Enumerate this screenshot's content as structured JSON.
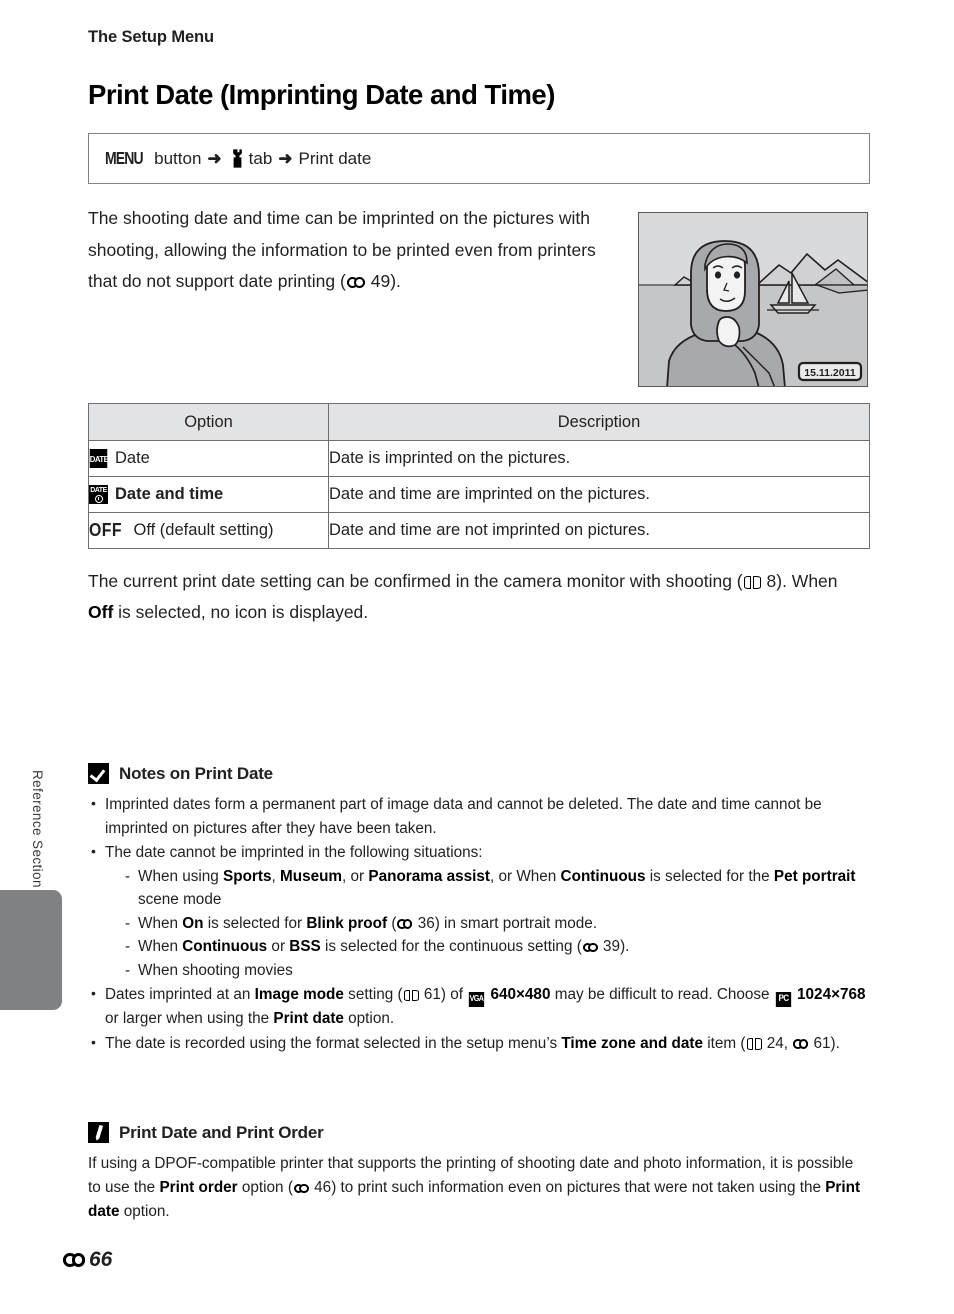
{
  "side_tab": {
    "label": "Reference Section"
  },
  "running_head": "The Setup Menu",
  "page_title": "Print Date (Imprinting Date and Time)",
  "menu_path": {
    "menu_label": "MENU",
    "button_word": "button",
    "arrow": "➜",
    "tab_icon": "wrench-icon",
    "tab_word": "tab",
    "destination": "Print date"
  },
  "intro": {
    "line1": "The shooting date and time can be imprinted on the",
    "line2": "pictures with shooting, allowing the information to be",
    "line3": "printed even from printers that do not support date",
    "line4_pre": "printing (",
    "line4_ref": "49",
    "line4_post": ")."
  },
  "camera_figure": {
    "alt": "camera monitor showing woman with sailboat and date stamp",
    "date_stamp": "15.11.2011",
    "sky_color": "#d9dadb",
    "sea_color": "#c5c6c8",
    "subject_color": "#a7a9ac"
  },
  "options_table": {
    "headers": [
      "Option",
      "Description"
    ],
    "rows": [
      {
        "icon": "date-badge-icon",
        "icon_text": "DATE",
        "option": "Date",
        "description": "Date is imprinted on the pictures."
      },
      {
        "icon": "date-time-badge-icon",
        "icon_text": "DATE",
        "option": "Date and time",
        "description": "Date and time are imprinted on the pictures."
      },
      {
        "icon": "off-glyph-icon",
        "icon_text": "OFF",
        "option": "Off (default setting)",
        "description": "Date and time are not imprinted on pictures."
      }
    ]
  },
  "confirm_paragraph": {
    "part1": "The current print date setting can be confirmed in the camera monitor with shooting (",
    "ref": "8",
    "part2": "). When ",
    "bold": "Off",
    "part3": " is selected, no icon is displayed."
  },
  "notes": {
    "icon": "check-box-icon",
    "title": "Notes on Print Date",
    "bullet1": "Imprinted dates form a permanent part of image data and cannot be deleted. The date and time cannot be imprinted on pictures after they have been taken.",
    "bullet2_lead": "The date cannot be imprinted in the following situations:",
    "sub1": {
      "t1": "When using ",
      "b1": "Sports",
      "t2": ", ",
      "b2": "Museum",
      "t3": ", or ",
      "b3": "Panorama assist",
      "t4": ", or When ",
      "b4": "Continuous",
      "t5": " is selected for the ",
      "b5": "Pet portrait",
      "t6": " scene mode"
    },
    "sub2": {
      "t1": "When ",
      "b1": "On",
      "t2": " is selected for ",
      "b2": "Blink proof",
      "t3": " (",
      "ref": "36",
      "t4": ") in smart portrait mode."
    },
    "sub3": {
      "t1": "When ",
      "b1": "Continuous",
      "t2": " or ",
      "b2": "BSS",
      "t3": " is selected for the continuous setting (",
      "ref": "39",
      "t4": ")."
    },
    "sub4": "When shooting movies",
    "bullet3": {
      "t1": "Dates imprinted at an ",
      "b1": "Image mode",
      "t2": " setting (",
      "ref1": "61",
      "t3": ") of ",
      "badge1": "VGA",
      "b2": "640×480",
      "t4": " may be difficult to read. Choose ",
      "badge2": "PC",
      "b3": "1024×768",
      "t5": " or larger when using the ",
      "b4": "Print date",
      "t6": " option."
    },
    "bullet4": {
      "t1": "The date is recorded using the format selected in the setup menu’s ",
      "b1": "Time zone and date",
      "t2": " item (",
      "ref_book": "24",
      "t3": ", ",
      "ref_e": "61",
      "t4": ")."
    }
  },
  "tip": {
    "icon": "pencil-icon",
    "title": "Print Date and Print Order",
    "t1": "If using a DPOF-compatible printer that supports the printing of shooting date and photo information, it is possible to use the ",
    "b1": "Print order",
    "t2": " option (",
    "ref": "46",
    "t3": ") to print such information even on pictures that were not taken using the ",
    "b2": "Print date",
    "t4": " option."
  },
  "footer": {
    "prefix_icon": "e-reference-icon",
    "page_number": "66"
  }
}
